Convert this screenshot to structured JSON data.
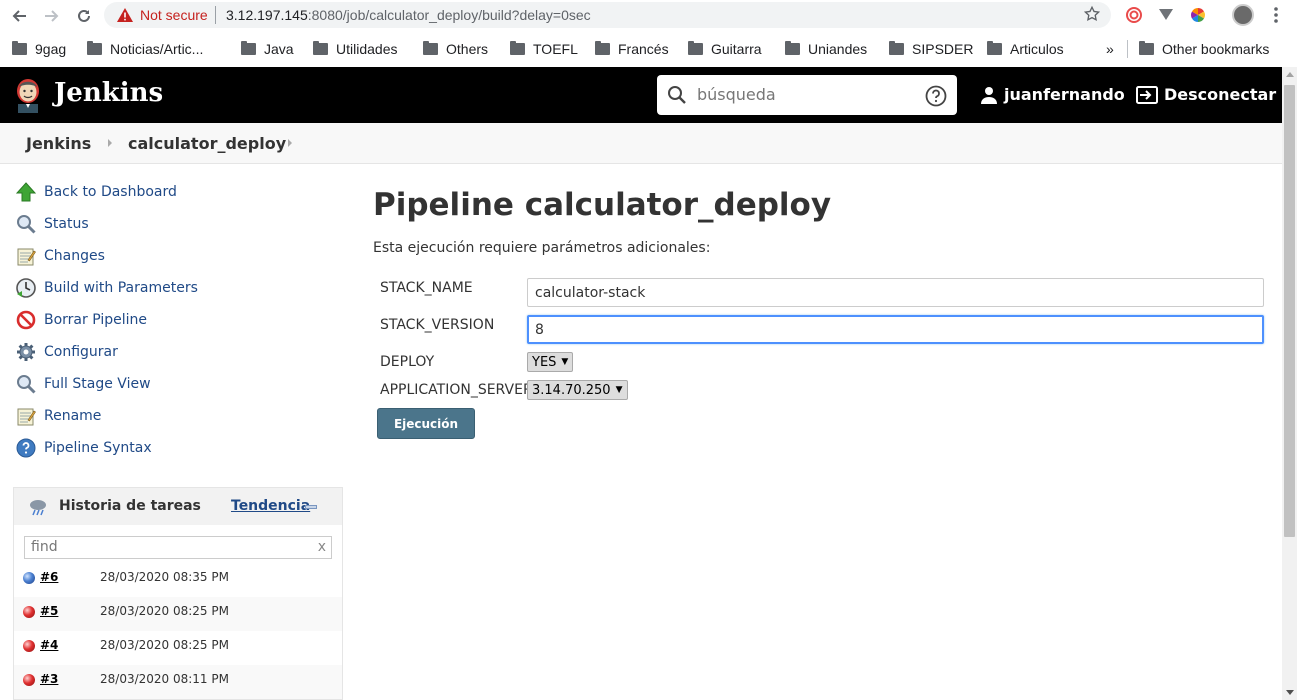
{
  "browser": {
    "security_label": "Not secure",
    "url_host": "3.12.197.145",
    "url_rest": ":8080/job/calculator_deploy/build?delay=0sec",
    "bookmarks": [
      "9gag",
      "Noticias/Artic...",
      "Java",
      "Utilidades",
      "Others",
      "TOEFL",
      "Francés",
      "Guitarra",
      "Uniandes",
      "SIPSDER",
      "Articulos"
    ],
    "overflow": "»",
    "other_bookmarks": "Other bookmarks"
  },
  "header": {
    "app_name": "Jenkins",
    "search_placeholder": "búsqueda",
    "user": "juanfernando",
    "logout": "Desconectar"
  },
  "breadcrumb": {
    "items": [
      "Jenkins",
      "calculator_deploy"
    ]
  },
  "sidebar": {
    "tasks": [
      {
        "label": "Back to Dashboard",
        "icon": "up-arrow-icon"
      },
      {
        "label": "Status",
        "icon": "magnifier-icon"
      },
      {
        "label": "Changes",
        "icon": "notepad-icon"
      },
      {
        "label": "Build with Parameters",
        "icon": "clock-icon"
      },
      {
        "label": "Borrar Pipeline",
        "icon": "no-entry-icon"
      },
      {
        "label": "Configurar",
        "icon": "gear-icon"
      },
      {
        "label": "Full Stage View",
        "icon": "magnifier-icon"
      },
      {
        "label": "Rename",
        "icon": "notepad-icon"
      },
      {
        "label": "Pipeline Syntax",
        "icon": "help-icon"
      }
    ],
    "history": {
      "title": "Historia de tareas",
      "trend": "Tendencia",
      "find_placeholder": "find",
      "clear": "x",
      "builds": [
        {
          "number": "#6",
          "date": "28/03/2020 08:35 PM",
          "status": "blue"
        },
        {
          "number": "#5",
          "date": "28/03/2020 08:25 PM",
          "status": "red"
        },
        {
          "number": "#4",
          "date": "28/03/2020 08:25 PM",
          "status": "red"
        },
        {
          "number": "#3",
          "date": "28/03/2020 08:11 PM",
          "status": "red"
        }
      ]
    }
  },
  "main": {
    "title": "Pipeline calculator_deploy",
    "description": "Esta ejecución requiere parámetros adicionales:",
    "params": {
      "stack_name": {
        "label": "STACK_NAME",
        "value": "calculator-stack"
      },
      "stack_version": {
        "label": "STACK_VERSION",
        "value": "8"
      },
      "deploy": {
        "label": "DEPLOY",
        "value": "YES"
      },
      "app_server": {
        "label": "APPLICATION_SERVER",
        "value": "3.14.70.250"
      }
    },
    "submit": "Ejecución"
  },
  "colors": {
    "header_bg": "#000000",
    "link": "#204a87",
    "button": "#4b758b",
    "focus": "#4d90fe"
  }
}
